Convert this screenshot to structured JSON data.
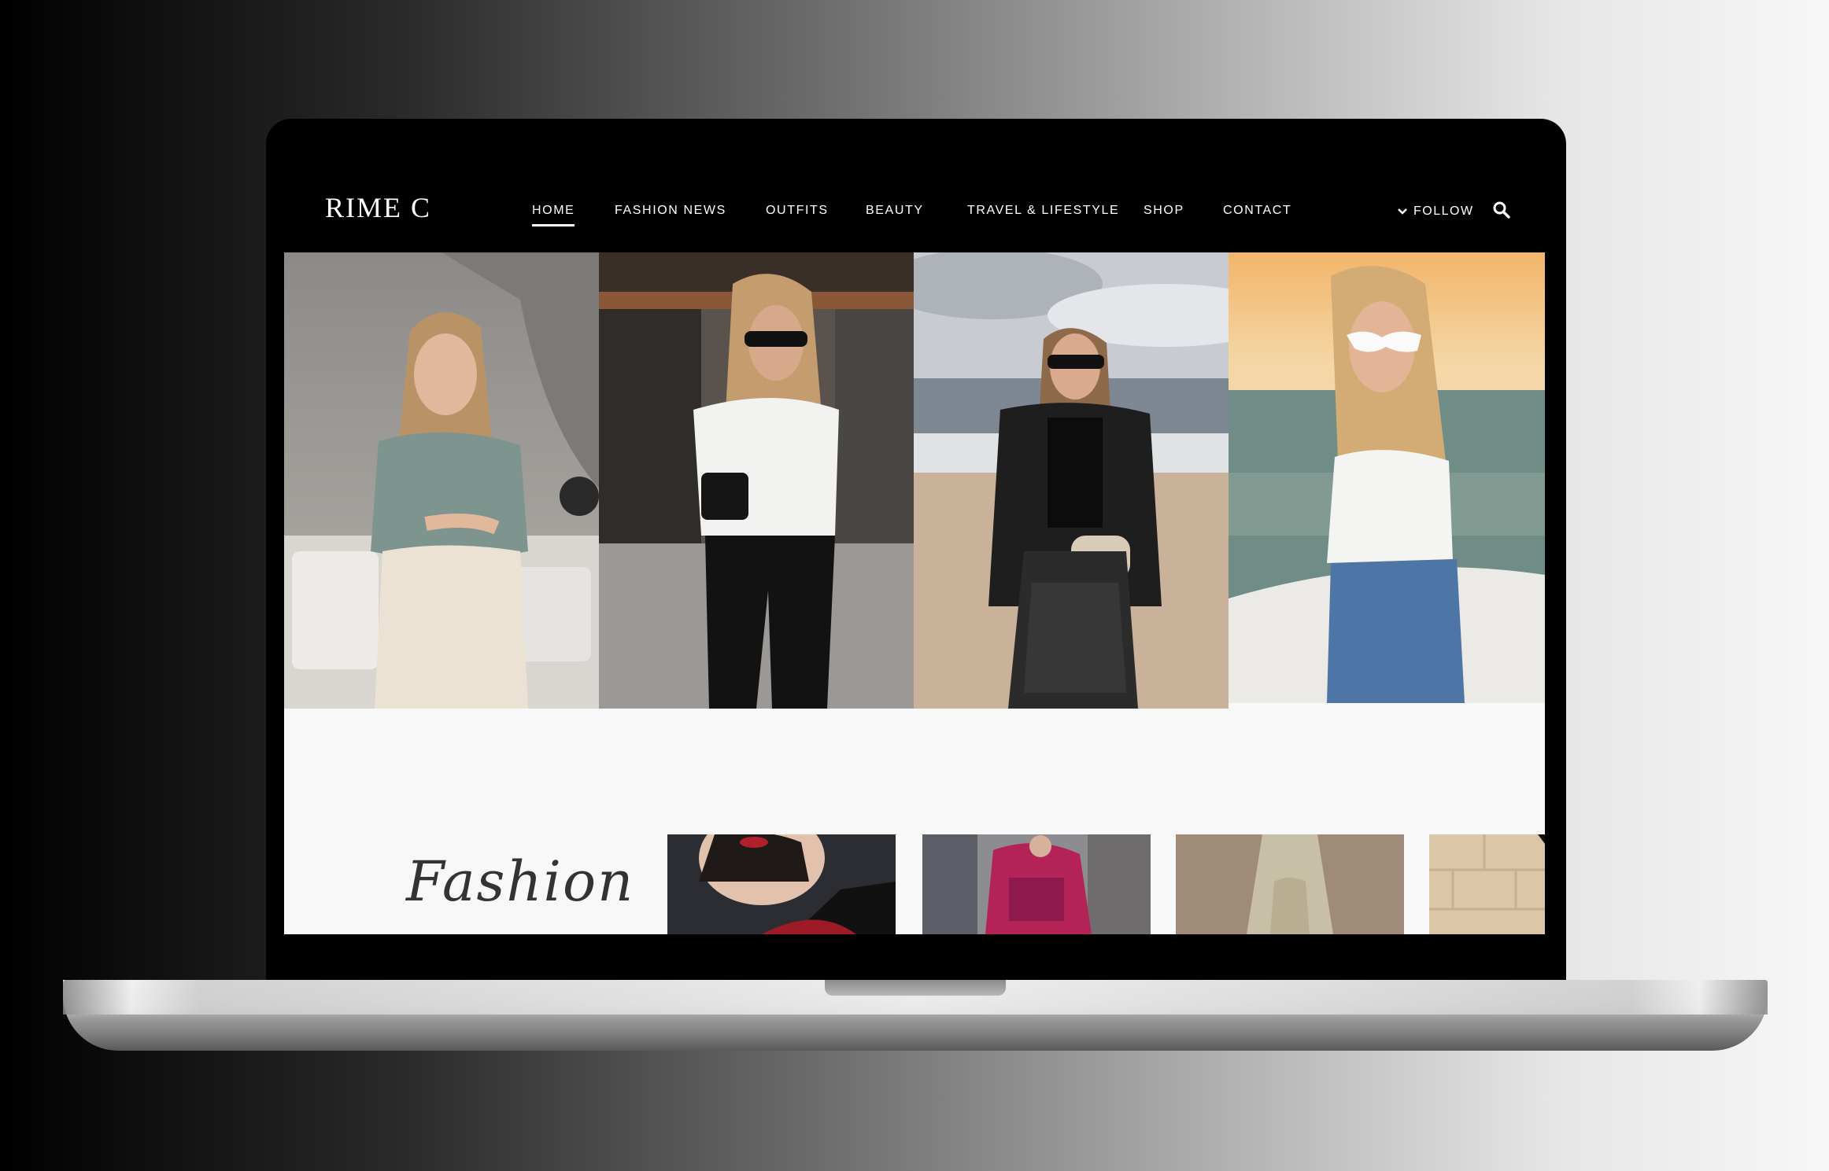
{
  "site": {
    "logo": "RIME C",
    "nav": [
      {
        "label": "HOME",
        "active": true
      },
      {
        "label": "FASHION NEWS",
        "active": false
      },
      {
        "label": "OUTFITS",
        "active": false
      },
      {
        "label": "BEAUTY",
        "active": false
      },
      {
        "label": "TRAVEL & LIFESTYLE",
        "active": false
      },
      {
        "label": "SHOP",
        "active": false
      },
      {
        "label": "CONTACT",
        "active": false
      }
    ],
    "follow_label": "FOLLOW"
  },
  "section": {
    "script_title": "Fashion"
  },
  "colors": {
    "header_bg": "#000000",
    "nav_text": "#ffffff",
    "content_bg": "#f8f8f8"
  },
  "icons": {
    "follow": "chevron-down-icon",
    "search": "search-icon"
  }
}
